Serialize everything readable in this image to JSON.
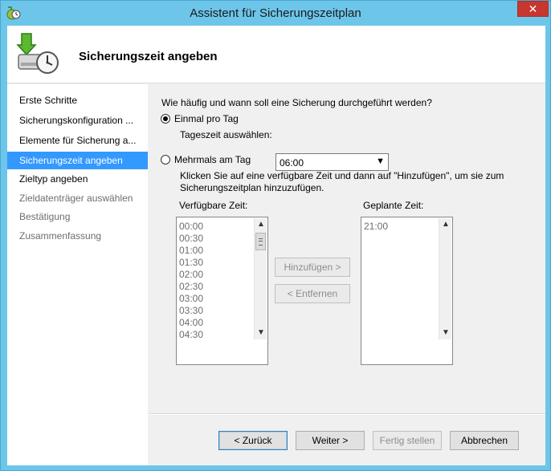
{
  "window": {
    "title": "Assistent für Sicherungszeitplan",
    "close_label": "✕"
  },
  "header": {
    "title": "Sicherungszeit angeben"
  },
  "nav": {
    "items": [
      {
        "label": "Erste Schritte",
        "state": "normal"
      },
      {
        "label": "Sicherungskonfiguration ...",
        "state": "normal"
      },
      {
        "label": "Elemente für Sicherung a...",
        "state": "normal"
      },
      {
        "label": "Sicherungszeit angeben",
        "state": "selected"
      },
      {
        "label": "Zieltyp angeben",
        "state": "normal"
      },
      {
        "label": "Zieldatenträger auswählen",
        "state": "disabled"
      },
      {
        "label": "Bestätigung",
        "state": "disabled"
      },
      {
        "label": "Zusammenfassung",
        "state": "disabled"
      }
    ]
  },
  "main": {
    "question": "Wie häufig und wann soll eine Sicherung durchgeführt werden?",
    "option_once": "Einmal pro Tag",
    "time_label": "Tageszeit auswählen:",
    "time_value": "06:00",
    "option_multiple": "Mehrmals am Tag",
    "instructions_line1": "Klicken Sie auf eine verfügbare Zeit und dann auf \"Hinzufügen\", um sie zum",
    "instructions_line2": "Sicherungszeitplan hinzuzufügen.",
    "available_label": "Verfügbare Zeit:",
    "scheduled_label": "Geplante Zeit:",
    "available_times": [
      "00:00",
      "00:30",
      "01:00",
      "01:30",
      "02:00",
      "02:30",
      "03:00",
      "03:30",
      "04:00",
      "04:30"
    ],
    "scheduled_times": [
      "21:00"
    ],
    "add_label": "Hinzufügen >",
    "remove_label": "< Entfernen"
  },
  "footer": {
    "back_label": "< Zurück",
    "next_label": "Weiter >",
    "finish_label": "Fertig stellen",
    "cancel_label": "Abbrechen"
  },
  "icons": {
    "app": "backup-schedule-icon",
    "header": "backup-clock-icon"
  },
  "colors": {
    "titlebar": "#6dc6ea",
    "selection": "#3399ff",
    "close": "#c7372f"
  }
}
